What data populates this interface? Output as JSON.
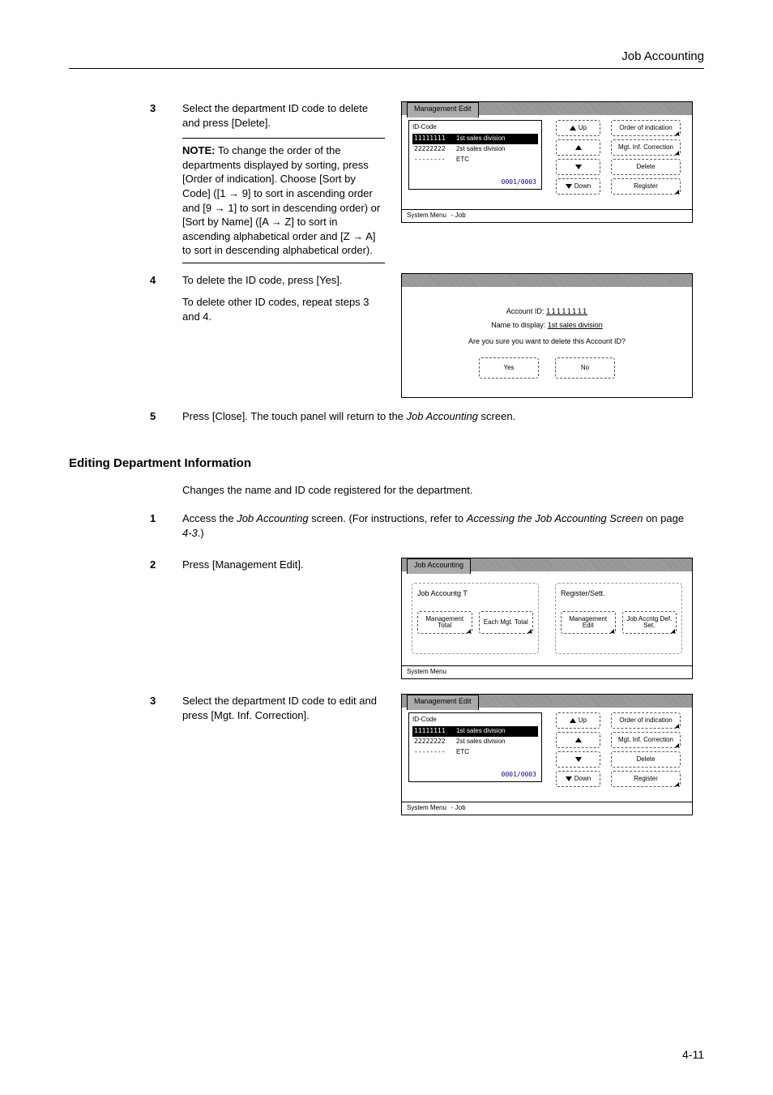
{
  "header": "Job Accounting",
  "page_number": "4-11",
  "italic_terms": {
    "job_accounting": "Job Accounting",
    "accessing_screen": "Accessing the Job Accounting Screen"
  },
  "steps_a": {
    "s3": {
      "num": "3",
      "text": "Select the department ID code to delete and press [Delete].",
      "note_label": "NOTE:",
      "note_text_1": " To change the order of the departments displayed by sorting, press [Order of indication]. Choose [Sort by Code] ([1 → 9] to sort in ascending order and [9 → 1] to sort in descending order) or [Sort by Name] ([A → Z] to sort in ascending alphabetical order and [Z → A] to sort in descending alphabetical order)."
    },
    "s4": {
      "num": "4",
      "text1": "To delete the ID code, press [Yes].",
      "text2": "To delete other ID codes, repeat steps 3 and 4."
    },
    "s5": {
      "num": "5",
      "text_before": "Press [Close]. The touch panel will return to the ",
      "text_after": " screen."
    }
  },
  "section_heading": "Editing Department Information",
  "section_intro": "Changes the name and ID code registered for the department.",
  "steps_b": {
    "s1": {
      "num": "1",
      "text_before": "Access the ",
      "text_mid": " screen. (For instructions, refer to ",
      "text_after1": " on page ",
      "page_ref": "4-3",
      "text_after2": ".)"
    },
    "s2": {
      "num": "2",
      "text": "Press [Management Edit]."
    },
    "s3": {
      "num": "3",
      "text": "Select the department ID code to edit and press [Mgt. Inf. Correction]."
    }
  },
  "screens": {
    "mgmt_edit": {
      "title": "Management Edit",
      "list_header": "ID-Code",
      "rows": [
        {
          "code": "11111111",
          "name": "1st sales division",
          "selected": true
        },
        {
          "code": "22222222",
          "name": "2st sales division",
          "selected": false
        },
        {
          "code": "--------",
          "name": "ETC",
          "selected": false
        }
      ],
      "pager": "0001/0003",
      "nav": {
        "up": "Up",
        "down": "Down"
      },
      "actions": {
        "order": "Order of indication",
        "correction": "Mgt. Inf. Correction",
        "delete": "Delete",
        "register": "Register"
      },
      "footer1": "System Menu",
      "footer2": "- Job"
    },
    "confirm": {
      "l1_label": "Account ID:",
      "l1_value": "11111111",
      "l2_label": "Name to display:",
      "l2_value": "1st sales division",
      "question": "Are you sure you want to delete this Account ID?",
      "yes": "Yes",
      "no": "No"
    },
    "job_acct": {
      "title": "Job Accounting",
      "left_title": "Job Accountg T",
      "right_title": "Register/Sett.",
      "btn_mgmt_total": "Management Total",
      "btn_each_total": "Each Mgt. Total",
      "btn_mgmt_edit": "Management Edit",
      "btn_def_set": "Job Accntg Def. Set.",
      "footer": "System Menu"
    }
  }
}
